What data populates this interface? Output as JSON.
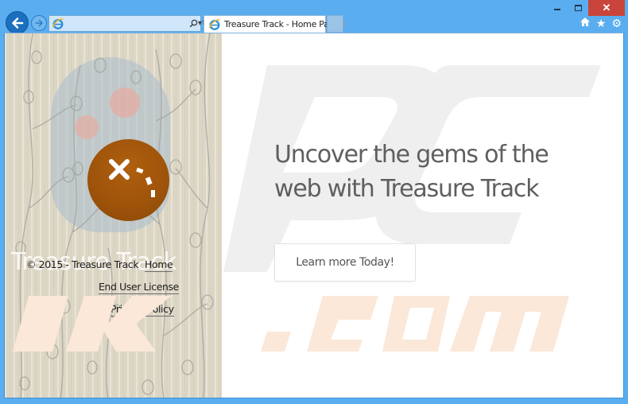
{
  "browser": {
    "address_value": "",
    "address_placeholder": "",
    "tab_title": "Treasure Track - Home Page",
    "tab_close_glyph": "✕",
    "window_controls": {
      "minimize": "minimize",
      "maximize": "maximize",
      "close_glyph": "✕"
    },
    "toolbar_icons": {
      "home": "⌂",
      "favorites": "★",
      "settings": "⚙"
    },
    "nav": {
      "back": "back-arrow",
      "forward": "forward-arrow",
      "search_glyph": "⚲",
      "dropdown_glyph": "▾",
      "refresh_glyph": "↻"
    }
  },
  "page": {
    "sidebar": {
      "brand_ghost": "Treasure Track",
      "copyright": "© 2015 - Treasure Track",
      "links": {
        "home": "Home",
        "eula": "End User License",
        "privacy": "Privacy Policy"
      }
    },
    "main": {
      "headline": "Uncover the gems of the web with Treasure Track",
      "cta_label": "Learn more Today!"
    },
    "colors": {
      "logo": "#9d530a",
      "headline": "#5f5f5f",
      "chrome": "#5aaef0",
      "close_button": "#c9443a"
    }
  }
}
